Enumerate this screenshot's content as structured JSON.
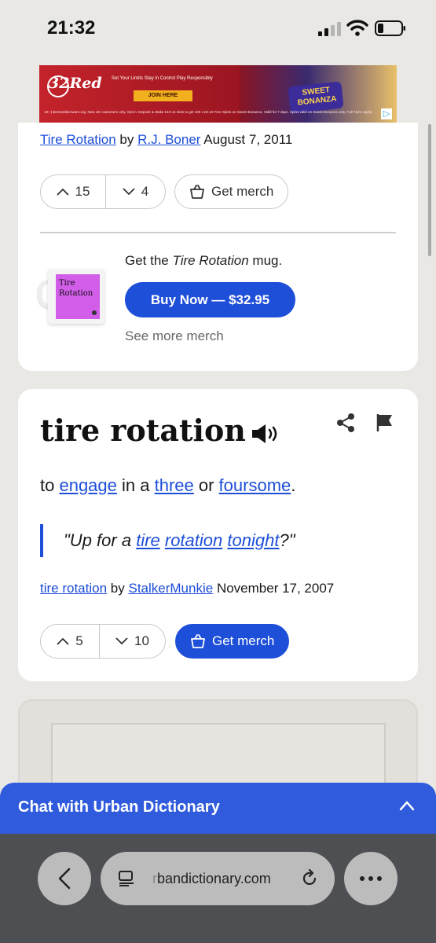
{
  "status_bar": {
    "time": "21:32"
  },
  "ad": {
    "brand": "32Red",
    "tagline": "Set Your Limits  Stay in Control  Play Responsibly",
    "join_label": "JOIN HERE",
    "game_name": "SWEET BONANZA",
    "fine_print": "18+ | BeGambleAware.org. New UK customers only. Opt in. Deposit & Stake £10 on slots to get 100 x £0.10 Free Spins on Sweet Bonanza. Valid for 7 days. Spins valid on Sweet Bonanza only. Full T&Cs apply."
  },
  "card1": {
    "byline_word": "Tire Rotation",
    "byline_by": "by",
    "byline_author": "R.J. Boner",
    "byline_date": "August 7, 2011",
    "upvotes": "15",
    "downvotes": "4",
    "merch_label": "Get merch",
    "mug_text_line1": "Tire",
    "mug_text_line2": "Rotation",
    "merch_prefix": "Get the",
    "merch_word": "Tire Rotation",
    "merch_suffix": "mug.",
    "buy_label": "Buy Now — $32.95",
    "see_more": "See more merch"
  },
  "card2": {
    "word": "tire rotation",
    "meaning": {
      "p1": "to ",
      "l1": "engage",
      "p2": " in a ",
      "l2": "three",
      "p3": " or ",
      "l3": "foursome",
      "p4": "."
    },
    "example": {
      "p1": "\"Up for a ",
      "l1": "tire",
      "s1": " ",
      "l2": "rotation",
      "s2": " ",
      "l3": "tonight",
      "p2": "?\""
    },
    "byline_word": "tire rotation",
    "byline_by": "by",
    "byline_author": "StalkerMunkie",
    "byline_date": "November 17, 2007",
    "upvotes": "5",
    "downvotes": "10",
    "merch_label": "Get merch"
  },
  "chat": {
    "label": "Chat with Urban Dictionary"
  },
  "browser": {
    "url_faded": "r",
    "url_text": "bandictionary.com"
  },
  "colors": {
    "accent": "#1e4fd8",
    "link": "#1d4ed8",
    "chat_bar": "#2f5bdc",
    "mug_print": "#d15de8"
  },
  "icons": [
    "signal-icon",
    "wifi-icon",
    "battery-icon",
    "chevron-up-icon",
    "chevron-down-icon",
    "shopping-bag-icon",
    "speaker-icon",
    "share-icon",
    "flag-icon",
    "back-arrow-icon",
    "tabs-icon",
    "reload-icon",
    "more-icon"
  ]
}
